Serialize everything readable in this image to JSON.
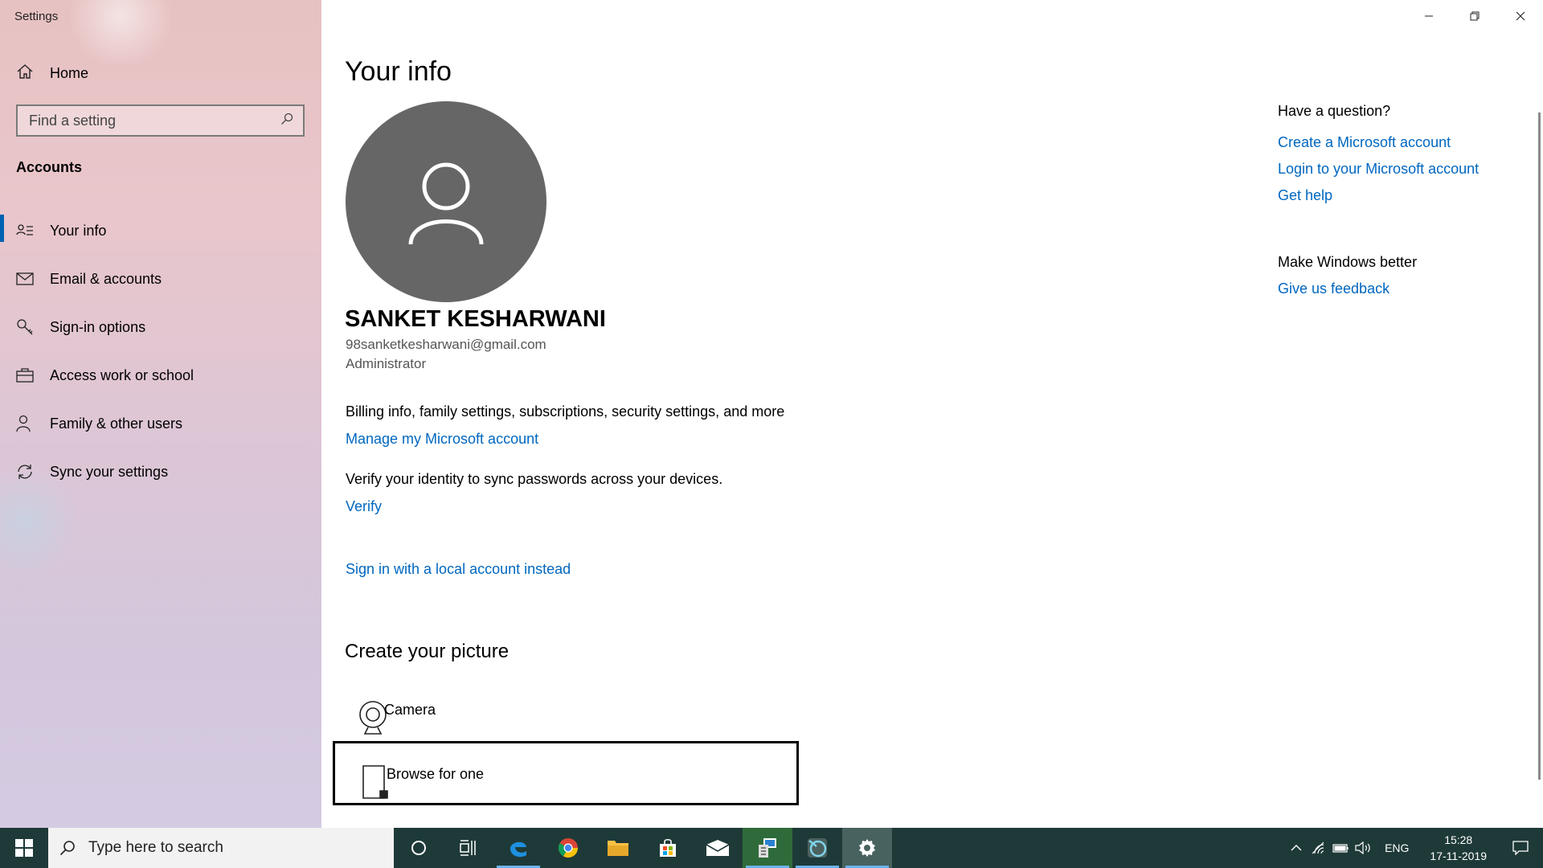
{
  "window": {
    "title": "Settings"
  },
  "sidebar": {
    "home_label": "Home",
    "search_placeholder": "Find a setting",
    "section_label": "Accounts",
    "items": [
      {
        "label": "Your info",
        "icon": "person-list-icon",
        "active": true
      },
      {
        "label": "Email & accounts",
        "icon": "mail-icon"
      },
      {
        "label": "Sign-in options",
        "icon": "key-icon"
      },
      {
        "label": "Access work or school",
        "icon": "briefcase-icon"
      },
      {
        "label": "Family & other users",
        "icon": "person-add-icon"
      },
      {
        "label": "Sync your settings",
        "icon": "sync-icon"
      }
    ]
  },
  "main": {
    "title": "Your info",
    "user": {
      "name": "SANKET KESHARWANI",
      "email": "98sanketkesharwani@gmail.com",
      "role": "Administrator"
    },
    "billing_text": "Billing info, family settings, subscriptions, security settings, and more",
    "manage_link": "Manage my Microsoft account",
    "verify_text": "Verify your identity to sync passwords across your devices.",
    "verify_link": "Verify",
    "local_account_link": "Sign in with a local account instead",
    "create_picture_heading": "Create your picture",
    "picture_options": [
      {
        "label": "Camera",
        "icon": "camera-icon"
      },
      {
        "label": "Browse for one",
        "icon": "browse-icon",
        "selected": true
      }
    ]
  },
  "right": {
    "question_heading": "Have a question?",
    "links": [
      "Create a Microsoft account",
      "Login to your Microsoft account",
      "Get help"
    ],
    "better_heading": "Make Windows better",
    "feedback_link": "Give us feedback"
  },
  "taskbar": {
    "search_placeholder": "Type here to search",
    "language": "ENG",
    "time": "15:28",
    "date": "17-11-2019"
  },
  "colors": {
    "accent": "#0063b1",
    "link": "#0067c0",
    "taskbar": "#1e3a38"
  }
}
